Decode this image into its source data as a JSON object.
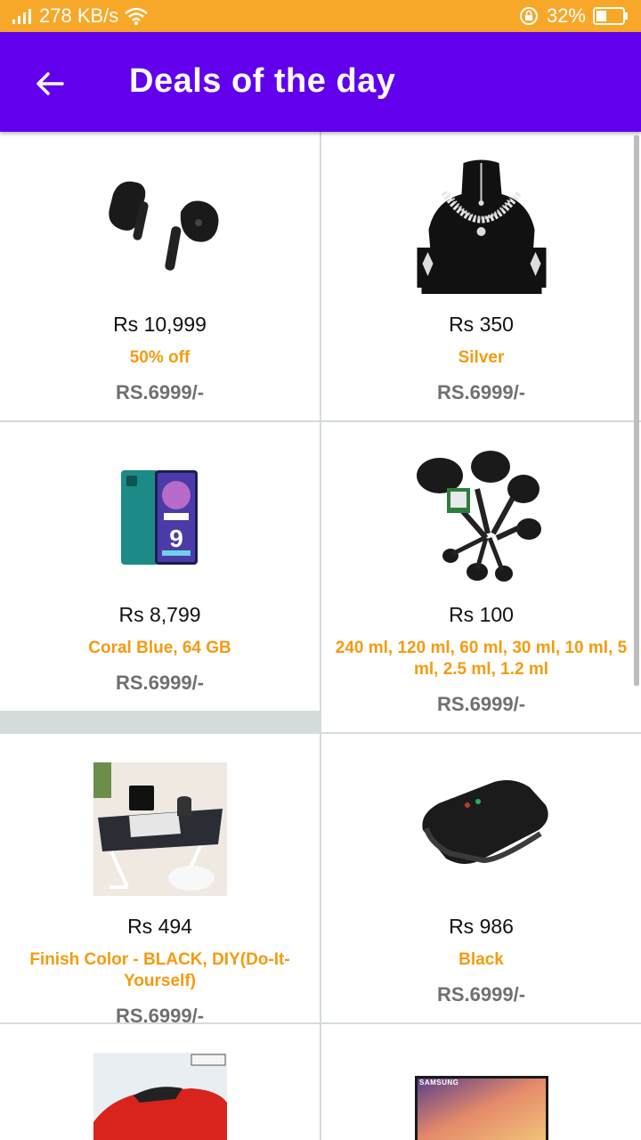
{
  "status_bar": {
    "speed": "278 KB/s",
    "battery": "32%"
  },
  "app_bar": {
    "title": "Deals of the day",
    "back_icon": "arrow-left-icon"
  },
  "colors": {
    "primary": "#6200ee",
    "status": "#f8a829",
    "accent": "#f59a0f"
  },
  "deals": [
    {
      "price": "Rs 10,999",
      "variant": "50% off",
      "mrp": "RS.6999/-",
      "image": "earbuds"
    },
    {
      "price": "Rs 350",
      "variant": "Silver",
      "mrp": "RS.6999/-",
      "image": "necklace-set"
    },
    {
      "price": "Rs 8,799",
      "variant": "Coral Blue, 64 GB",
      "mrp": "RS.6999/-",
      "image": "smartphone"
    },
    {
      "price": "Rs 100",
      "variant": "240 ml, 120 ml, 60 ml, 30 ml, 10 ml, 5 ml, 2.5 ml, 1.2 ml",
      "mrp": "RS.6999/-",
      "image": "measuring-cups"
    },
    {
      "price": "Rs 494",
      "variant": "Finish Color - BLACK, DIY(Do-It-Yourself)",
      "mrp": "RS.6999/-",
      "image": "laptop-table"
    },
    {
      "price": "Rs 986",
      "variant": "Black",
      "mrp": "RS.6999/-",
      "image": "sandwich-maker"
    },
    {
      "image": "toy-car"
    },
    {
      "image": "samsung-tv",
      "tv_brand": "SAMSUNG"
    }
  ]
}
